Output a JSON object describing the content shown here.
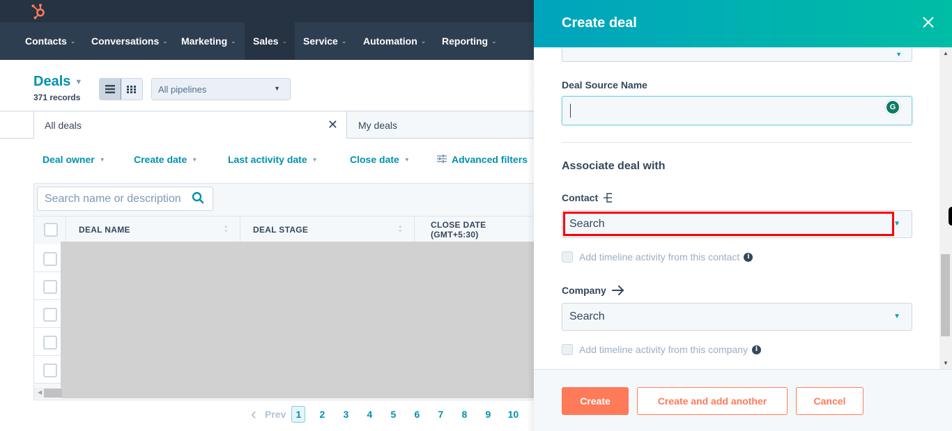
{
  "colors": {
    "nav_bg": "#2d3e50",
    "topbar_bg": "#253342",
    "accent_teal": "#0091ae",
    "brand_orange": "#ff7a59",
    "panel_gradient_start": "#00a4bd",
    "panel_gradient_end": "#00bda5",
    "highlight_red": "#ff0000"
  },
  "nav": {
    "logo": "hubspot-sprocket-icon",
    "items": [
      {
        "label": "Contacts",
        "active": false
      },
      {
        "label": "Conversations",
        "active": false
      },
      {
        "label": "Marketing",
        "active": false
      },
      {
        "label": "Sales",
        "active": true
      },
      {
        "label": "Service",
        "active": false
      },
      {
        "label": "Automation",
        "active": false
      },
      {
        "label": "Reporting",
        "active": false
      }
    ]
  },
  "header": {
    "title": "Deals",
    "record_count": "371 records",
    "view_toggle": {
      "list_icon": "list-view-icon",
      "board_icon": "board-view-icon",
      "selected": "list"
    },
    "pipeline_select": "All pipelines"
  },
  "tabs": [
    {
      "label": "All deals",
      "active": true,
      "closable": true
    },
    {
      "label": "My deals",
      "active": false
    }
  ],
  "filters": [
    {
      "label": "Deal owner",
      "has_caret": true
    },
    {
      "label": "Create date",
      "has_caret": true
    },
    {
      "label": "Last activity date",
      "has_caret": true
    },
    {
      "label": "Close date",
      "has_caret": true
    },
    {
      "label": "Advanced filters",
      "icon": "sliders-icon"
    }
  ],
  "table": {
    "search_placeholder": "Search name or description",
    "columns": [
      "DEAL NAME",
      "DEAL STAGE",
      "CLOSE DATE (GMT+5:30)"
    ],
    "visible_rows": 5
  },
  "pagination": {
    "prev_label": "Prev",
    "pages": [
      "1",
      "2",
      "3",
      "4",
      "5",
      "6",
      "7",
      "8",
      "9",
      "10"
    ],
    "current": "1"
  },
  "panel": {
    "title": "Create deal",
    "deal_source_label": "Deal Source Name",
    "deal_source_value": "",
    "associate_heading": "Associate deal with",
    "contact_label": "Contact",
    "contact_placeholder": "Search",
    "contact_timeline_label": "Add timeline activity from this contact",
    "company_label": "Company",
    "company_placeholder": "Search",
    "company_timeline_label": "Add timeline activity from this company",
    "buttons": {
      "create": "Create",
      "create_another": "Create and add another",
      "cancel": "Cancel"
    }
  }
}
